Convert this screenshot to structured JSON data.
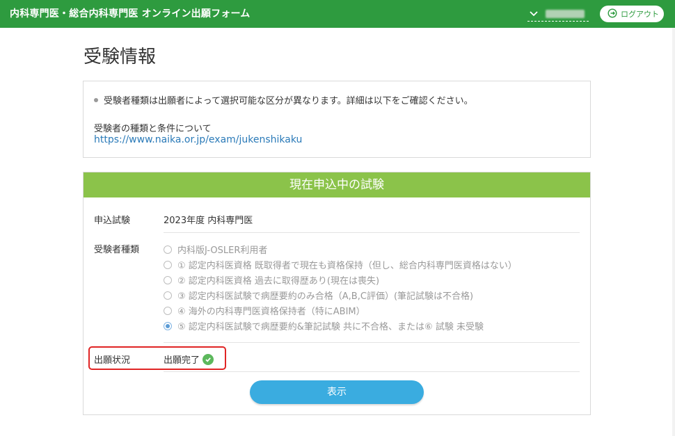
{
  "header": {
    "app_title": "内科専門医・総合内科専門医 オンライン出願フォーム",
    "logout_label": "ログアウト"
  },
  "page": {
    "title": "受験情報"
  },
  "info": {
    "notice": "受験者種類は出願者によって選択可能な区分が異なります。詳細は以下をご確認ください。",
    "conditions_label": "受験者の種類と条件について",
    "conditions_link": "https://www.naika.or.jp/exam/jukenshikaku"
  },
  "panel": {
    "header": "現在申込中の試験",
    "exam": {
      "label": "申込試験",
      "value": "2023年度 内科専門医"
    },
    "examinee_type": {
      "label": "受験者種類",
      "options": [
        {
          "label": "内科版J-OSLER利用者",
          "checked": false
        },
        {
          "label": "① 認定内科医資格 既取得者で現在も資格保持（但し、総合内科専門医資格はない）",
          "checked": false
        },
        {
          "label": "② 認定内科医資格 過去に取得歴あり(現在は喪失)",
          "checked": false
        },
        {
          "label": "③ 認定内科医試験で病歴要約のみ合格（A,B,C評価）(筆記試験は不合格)",
          "checked": false
        },
        {
          "label": "④ 海外の内科専門医資格保持者（特にABIM）",
          "checked": false
        },
        {
          "label": "⑤ 認定内科医試験で病歴要約&筆記試験 共に不合格、または⑥ 試験 未受験",
          "checked": true
        }
      ]
    },
    "status": {
      "label": "出願状況",
      "value": "出願完了"
    },
    "show_button": "表示"
  },
  "colors": {
    "header_green": "#2e9b3f",
    "panel_green": "#8bc34a",
    "button_blue": "#3aace0",
    "link_blue": "#2a7ab8",
    "highlight_red": "#e02424",
    "check_green": "#5cb85c"
  },
  "icons": [
    "chevron-down-icon",
    "logout-icon",
    "check-circle-icon",
    "radio-button-icon"
  ]
}
